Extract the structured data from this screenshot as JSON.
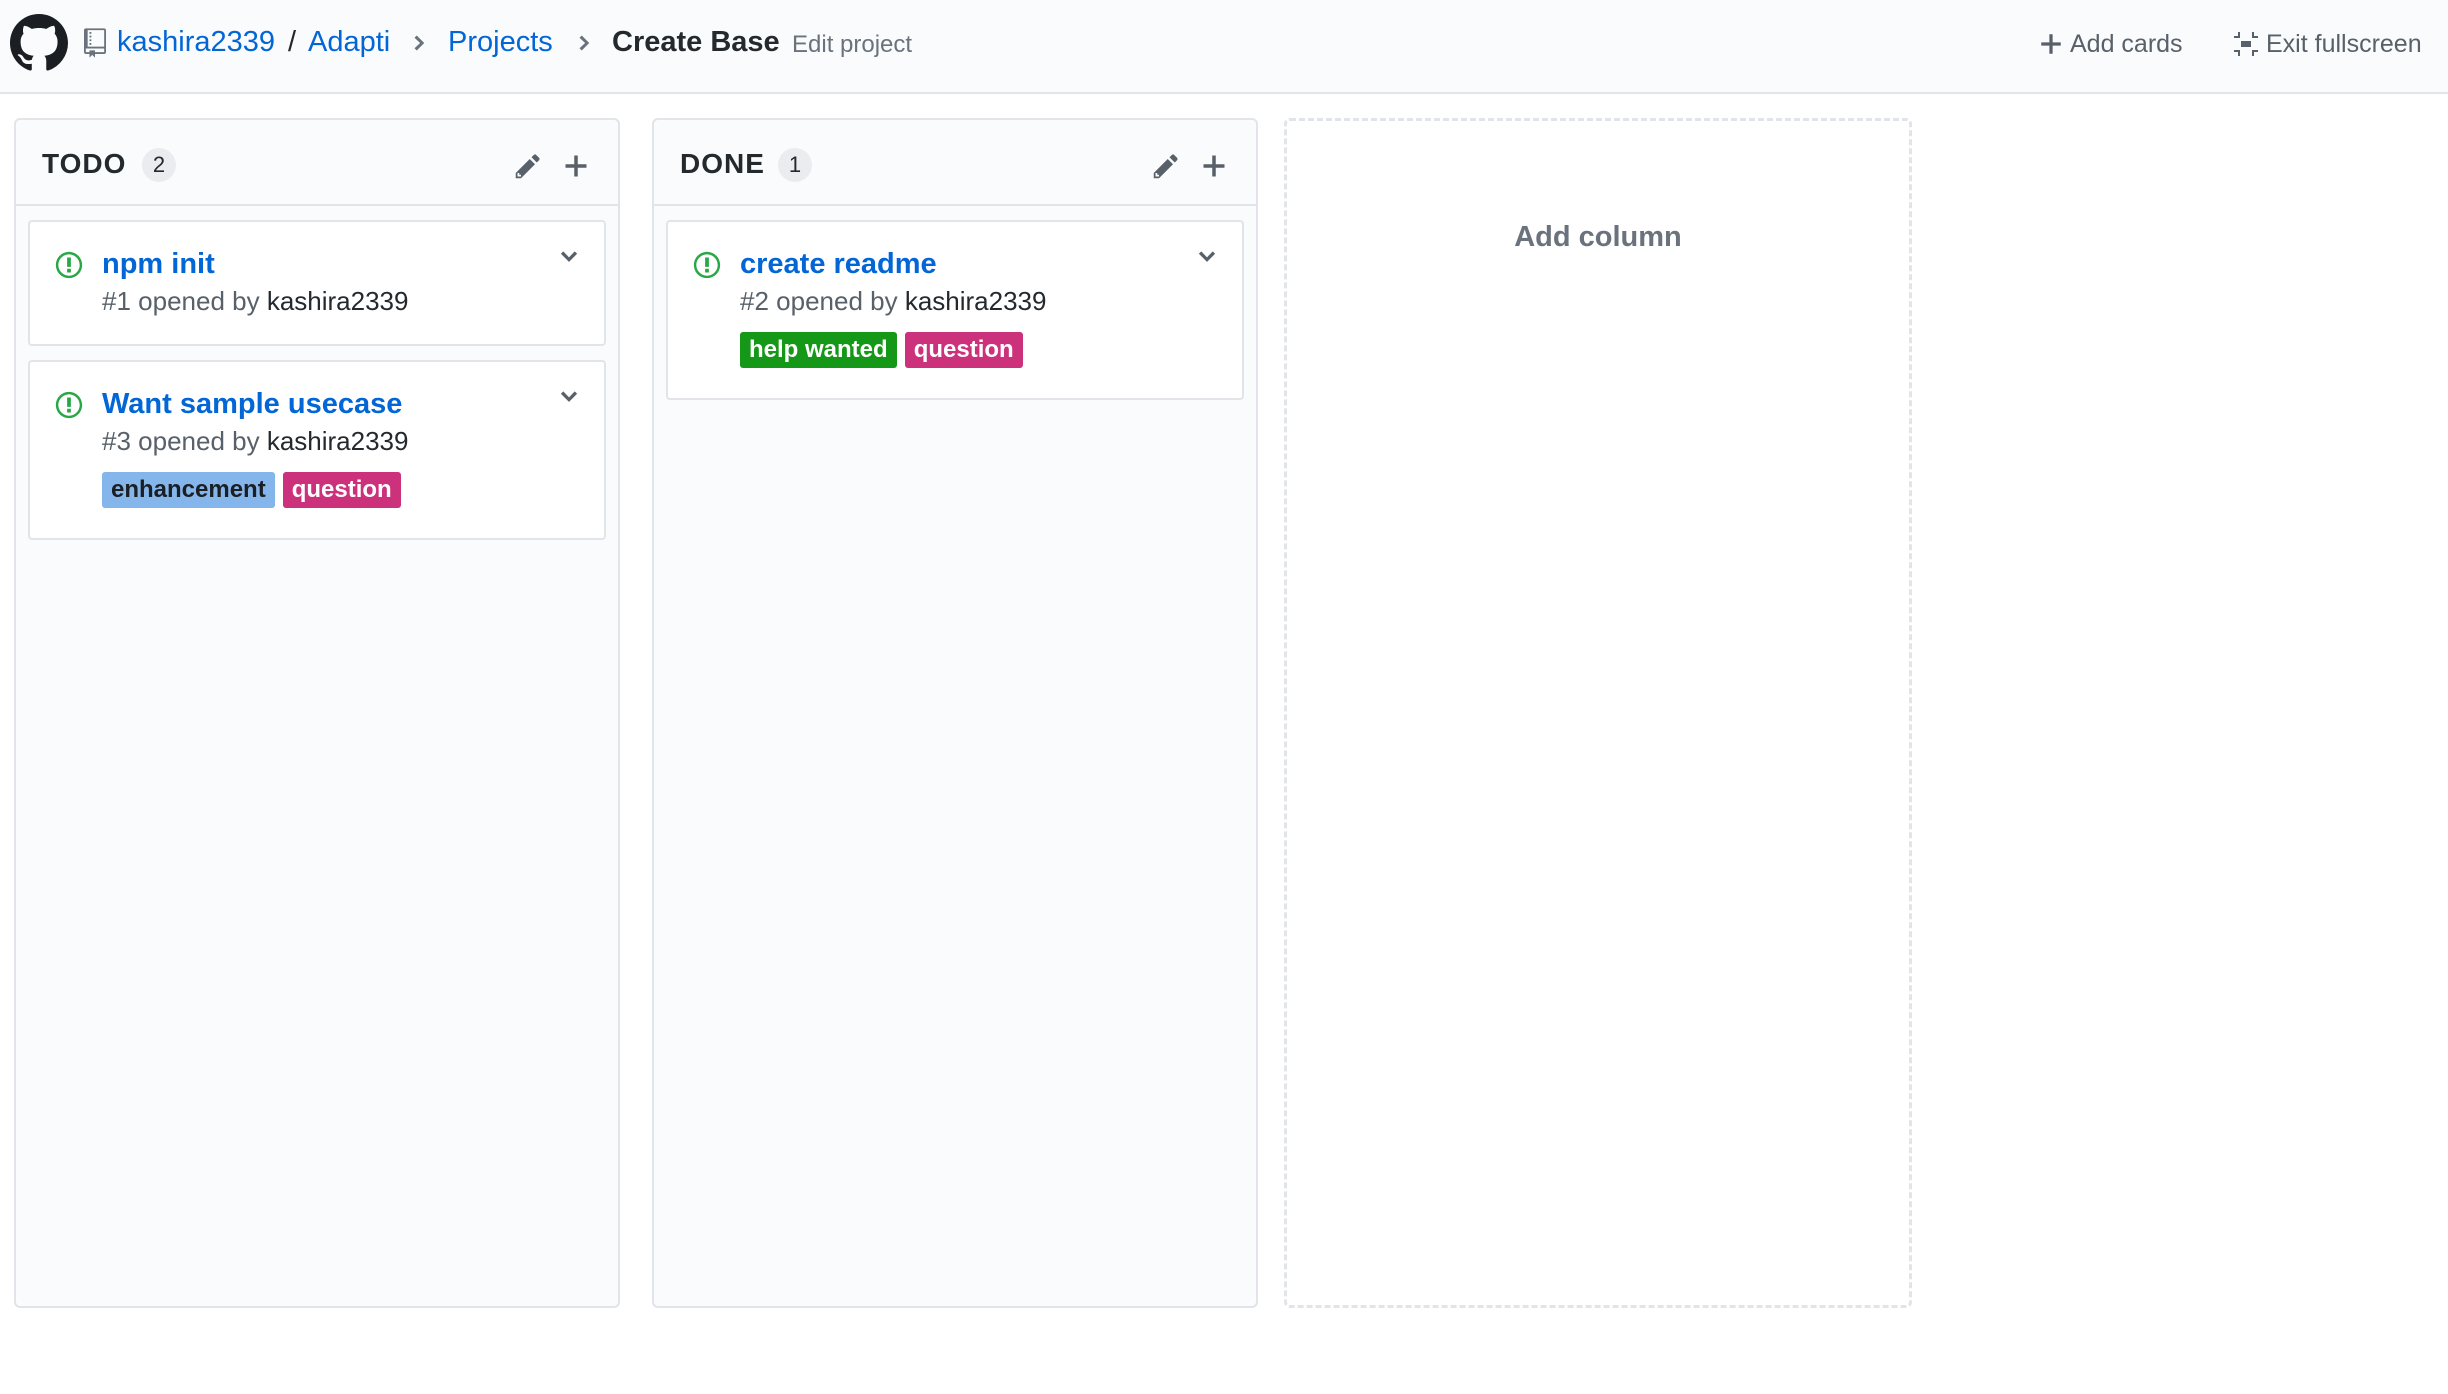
{
  "header": {
    "owner": "kashira2339",
    "separator": "/",
    "repo": "Adapti",
    "projects": "Projects",
    "project_name": "Create Base",
    "edit_label": "Edit project",
    "add_cards_label": "Add cards",
    "exit_fullscreen_label": "Exit fullscreen"
  },
  "colors": {
    "link": "#0366d6",
    "open_issue": "#28a745",
    "label_enhancement": "#84b6eb",
    "label_question": "#cc317c",
    "label_help_wanted": "#159818"
  },
  "columns": [
    {
      "title": "TODO",
      "count": "2",
      "cards": [
        {
          "title": "npm init",
          "number_text": "#1 opened by ",
          "user": "kashira2339",
          "labels": []
        },
        {
          "title": "Want sample usecase",
          "number_text": "#3 opened by ",
          "user": "kashira2339",
          "labels": [
            {
              "text": "enhancement"
            },
            {
              "text": "question"
            }
          ]
        }
      ]
    },
    {
      "title": "DONE",
      "count": "1",
      "cards": [
        {
          "title": "create readme",
          "number_text": "#2 opened by ",
          "user": "kashira2339",
          "labels": [
            {
              "text": "help wanted"
            },
            {
              "text": "question"
            }
          ]
        }
      ]
    }
  ],
  "add_column_label": "Add column"
}
